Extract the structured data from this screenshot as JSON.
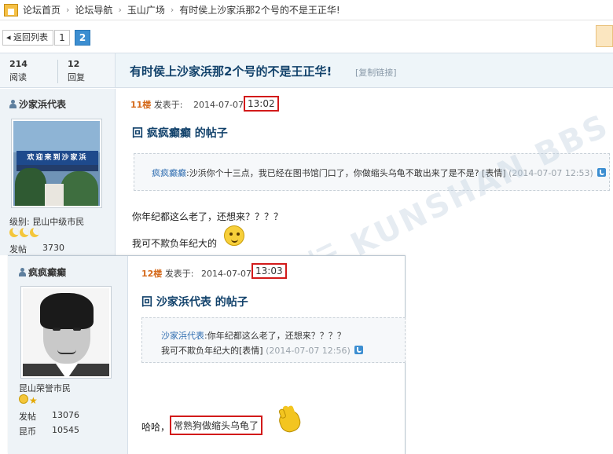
{
  "breadcrumb": {
    "items": [
      "论坛首页",
      "论坛导航",
      "玉山广场",
      "有时侯上沙家浜那2个号的不是王正华!"
    ],
    "separator": "›"
  },
  "pager": {
    "back_label": "◂ 返回列表",
    "pages": [
      "1",
      "2"
    ],
    "current_page": "2"
  },
  "thread": {
    "reads_count": "214",
    "reads_label": "阅读",
    "replies_count": "12",
    "replies_label": "回复",
    "title": "有时侯上沙家浜那2个号的不是王正华!",
    "copy_link_label": "[复制链接]"
  },
  "post11": {
    "username": "沙家浜代表",
    "avatar_sign_text": "欢迎来到沙家浜",
    "rank_label": "级别: 昆山中级市民",
    "stats": [
      {
        "label": "发帖",
        "value": "3730"
      }
    ],
    "floor": "11楼",
    "posted_label": "发表于:",
    "date": "2014-07-07",
    "time": "13:02",
    "reply_title": "回  疯疯癫癫  的帖子",
    "quote_user": "疯疯癫癫",
    "quote_text": ":沙浜你个十三点，我已经在图书馆门口了，你做缩头乌龟不敢出来了是不是? [表情]",
    "quote_time": "(2014-07-07 12:53)",
    "lines": [
      "你年纪都这么老了，还想来？？？？",
      "我可不欺负年纪大的"
    ]
  },
  "post12": {
    "username": "疯疯癫癫",
    "rank_label": "昆山荣誉市民",
    "stats": [
      {
        "label": "发帖",
        "value": "13076"
      },
      {
        "label": "昆币",
        "value": "10545"
      }
    ],
    "floor": "12楼",
    "posted_label": "发表于:",
    "date": "2014-07-07",
    "time": "13:03",
    "reply_title": "回  沙家浜代表  的帖子",
    "quote_user": "沙家浜代表",
    "quote_text": ":你年纪都这么老了，还想来？？？？",
    "quote_line2": "我可不欺负年纪大的[表情]",
    "quote_time": "(2014-07-07 12:56)",
    "line_prefix": "哈哈，",
    "line_highlight": "常熟狗做缩头乌龟了"
  },
  "watermark": "昆山论坛 KUNSHAN BBS",
  "colors": {
    "accent": "#3c8ed1",
    "title": "#12426b",
    "highlight_border": "#d21a1a",
    "floor": "#d56a1b"
  }
}
